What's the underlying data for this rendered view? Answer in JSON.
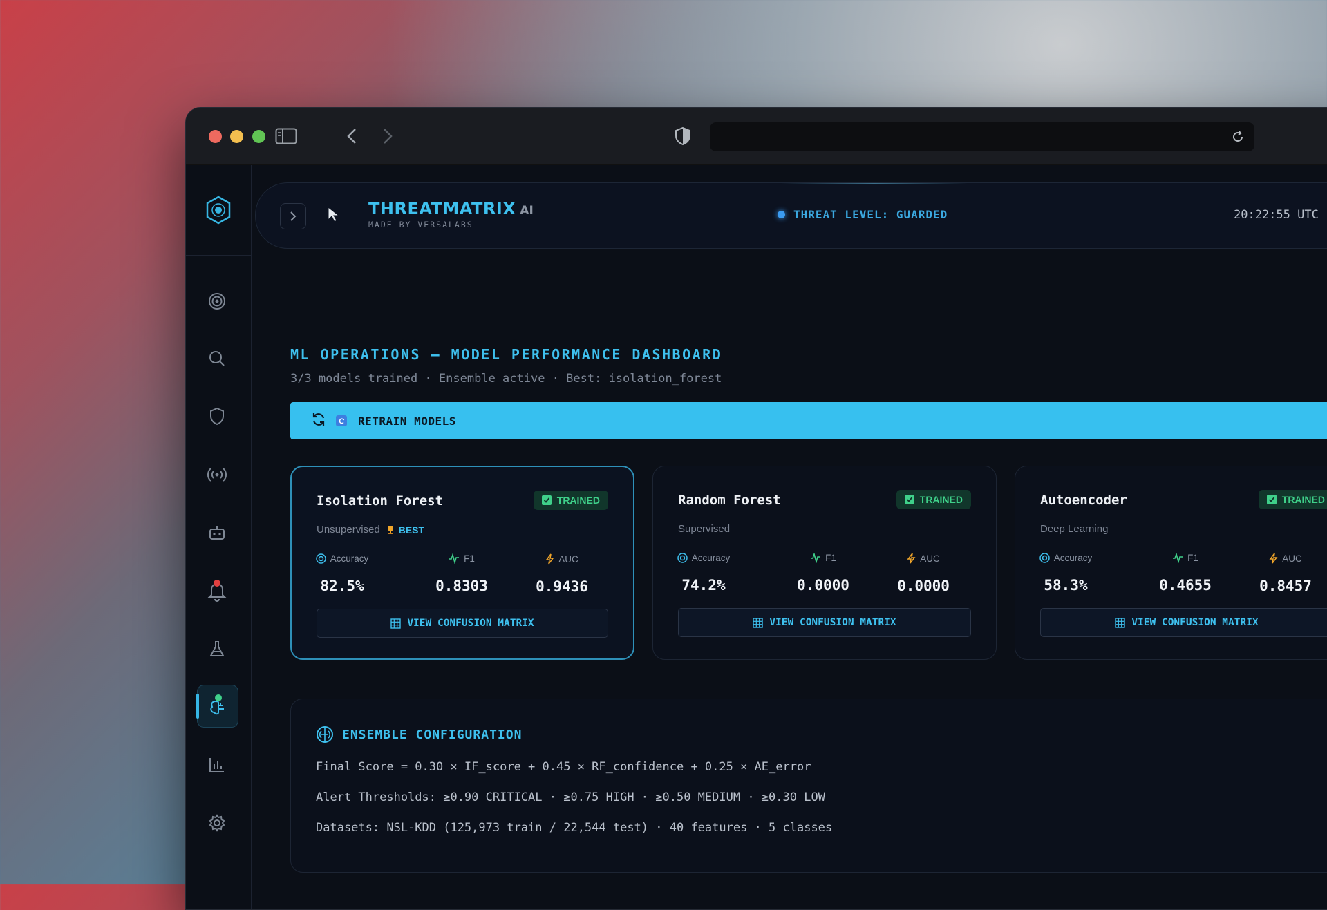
{
  "app": {
    "brand_title": "THREATMATRIX",
    "brand_ai": "AI",
    "brand_sub": "MADE BY VERSALABS",
    "threat_level": "THREAT LEVEL: GUARDED",
    "clock": "20:22:55 UTC"
  },
  "page": {
    "title": "ML OPERATIONS — MODEL PERFORMANCE DASHBOARD",
    "subtitle": "3/3 models trained · Ensemble active · Best: isolation_forest",
    "retrain_label": "RETRAIN MODELS"
  },
  "metric_labels": {
    "accuracy": "Accuracy",
    "f1": "F1",
    "auc": "AUC"
  },
  "models": [
    {
      "name": "Isolation Forest",
      "type": "Unsupervised",
      "best_label": "BEST",
      "status": "TRAINED",
      "accuracy": "82.5%",
      "f1": "0.8303",
      "auc": "0.9436",
      "cm_label": "VIEW CONFUSION MATRIX"
    },
    {
      "name": "Random Forest",
      "type": "Supervised",
      "status": "TRAINED",
      "accuracy": "74.2%",
      "f1": "0.0000",
      "auc": "0.0000",
      "cm_label": "VIEW CONFUSION MATRIX"
    },
    {
      "name": "Autoencoder",
      "type": "Deep Learning",
      "status": "TRAINED",
      "accuracy": "58.3%",
      "f1": "0.4655",
      "auc": "0.8457",
      "cm_label": "VIEW CONFUSION MATRIX"
    }
  ],
  "ensemble": {
    "title": "ENSEMBLE CONFIGURATION",
    "formula": "Final Score = 0.30 × IF_score + 0.45 × RF_confidence + 0.25 × AE_error",
    "thresholds": "Alert Thresholds: ≥0.90 CRITICAL · ≥0.75 HIGH · ≥0.50 MEDIUM · ≥0.30 LOW",
    "datasets": "Datasets: NSL-KDD (125,973 train / 22,544 test) · 40 features · 5 classes"
  },
  "colors": {
    "accent": "#3ec0ee",
    "success": "#3fd08a",
    "warning": "#f0a52a",
    "background": "#0b0f17"
  },
  "sidebar_icons": [
    "hexagon-logo-icon",
    "target-icon",
    "search-icon",
    "shield-icon",
    "broadcast-icon",
    "robot-icon",
    "bell-icon",
    "flask-icon",
    "brain-icon",
    "bar-chart-icon",
    "gear-icon"
  ]
}
